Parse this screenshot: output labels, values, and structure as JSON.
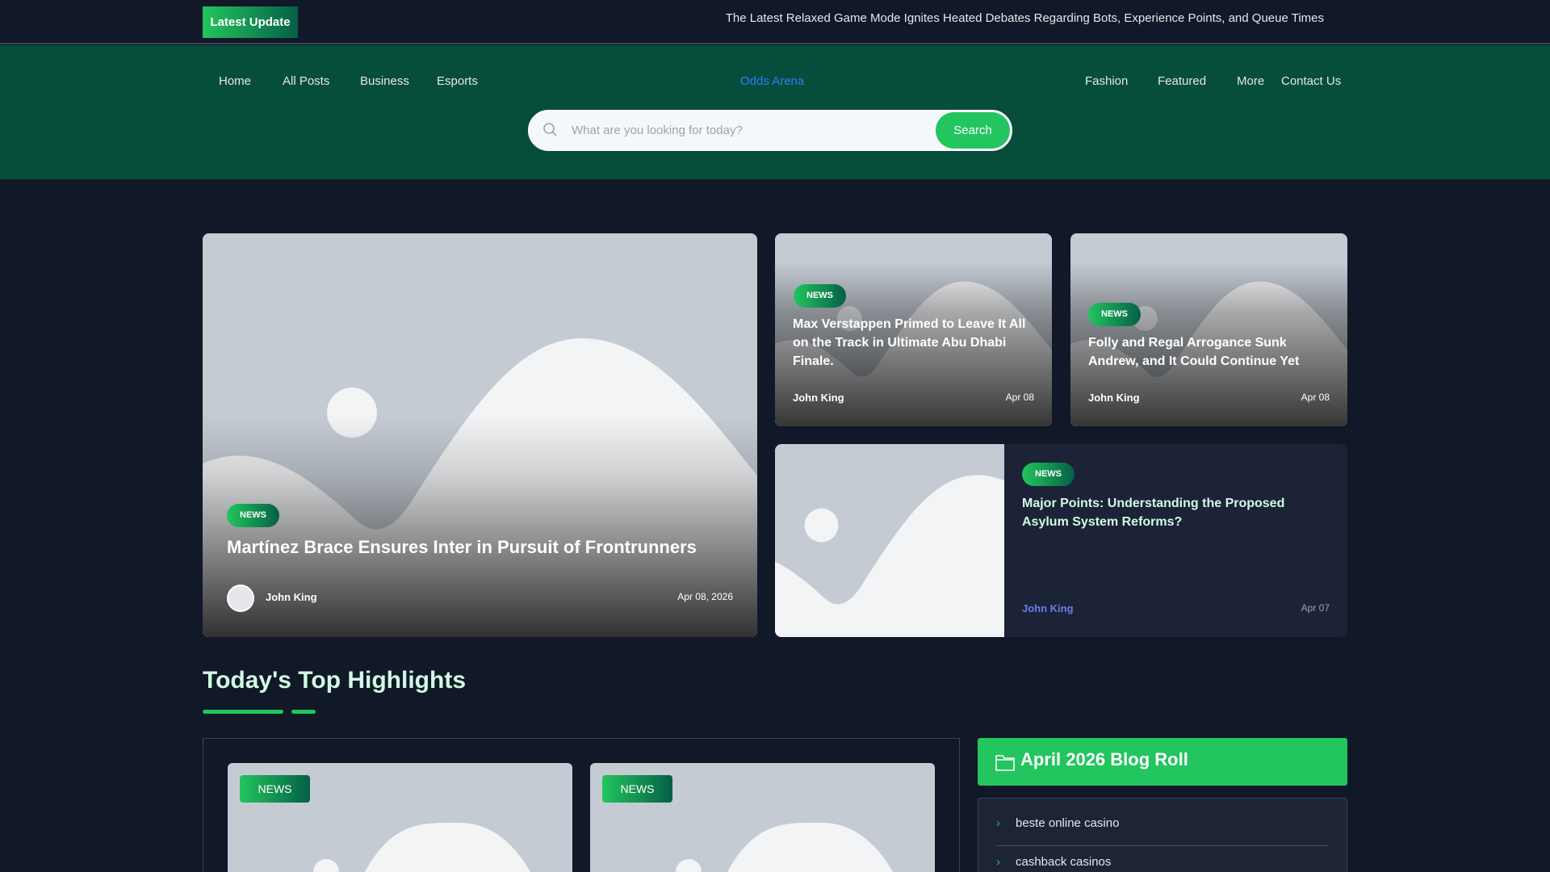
{
  "topbar": {
    "latest_label": "Latest  Update",
    "ticker": "The Latest Relaxed Game Mode Ignites Heated Debates Regarding Bots, Experience Points, and Queue Times"
  },
  "nav": {
    "items": [
      "Home",
      "All Posts",
      "Business",
      "Esports"
    ],
    "brand": "Odds Arena",
    "right_items": [
      "Fashion",
      "Featured",
      "More",
      "Contact Us"
    ]
  },
  "search": {
    "placeholder": "What are you looking for today?",
    "button": "Search"
  },
  "hero": {
    "badge": "NEWS",
    "title": "Martínez Brace Ensures Inter in Pursuit of Frontrunners",
    "author": "John King",
    "date": "Apr 08, 2026"
  },
  "cards": [
    {
      "badge": "NEWS",
      "title": "Max Verstappen Primed to Leave It All on the Track in Ultimate Abu Dhabi Finale.",
      "author": "John King",
      "date": "Apr 08"
    },
    {
      "badge": "NEWS",
      "title": "Folly and Regal Arrogance Sunk Andrew, and It Could Continue Yet",
      "author": "John King",
      "date": "Apr 08"
    },
    {
      "badge": "NEWS",
      "title": "Major Points: Understanding the Proposed Asylum System Reforms?",
      "author": "John King",
      "date": "Apr 07"
    }
  ],
  "highlights": {
    "title": "Today's Top Highlights",
    "cards": [
      {
        "badge": "NEWS"
      },
      {
        "badge": "NEWS"
      }
    ]
  },
  "blogroll": {
    "title": "April 2026 Blog Roll",
    "items": [
      "beste online casino",
      "cashback casinos"
    ]
  },
  "colors": {
    "accent": "#22c55e",
    "nav_bg": "#064e3b",
    "page_bg": "#111827",
    "brand_link": "#2f7cf6"
  }
}
